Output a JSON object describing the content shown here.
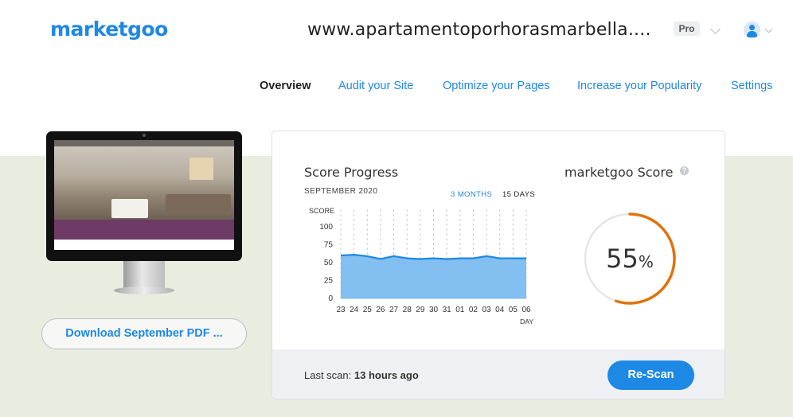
{
  "header": {
    "logo": "marketgoo",
    "site_url": "www.apartamentoporhorasmarbella....",
    "plan": "Pro",
    "user_icon": "user-icon"
  },
  "nav": {
    "items": [
      "Overview",
      "Audit your Site",
      "Optimize your Pages",
      "Increase your Popularity",
      "Settings"
    ],
    "active": "Overview"
  },
  "preview": {
    "download_label": "Download September PDF ..."
  },
  "score_progress": {
    "title": "Score Progress",
    "month": "SEPTEMBER 2020",
    "range_options": [
      "3 MONTHS",
      "15 DAYS"
    ],
    "selected_range": "15 DAYS"
  },
  "chart_data": {
    "type": "area",
    "ylabel": "SCORE",
    "xlabel": "DAY",
    "ylim": [
      0,
      100
    ],
    "yticks": [
      0,
      25,
      50,
      75,
      100
    ],
    "categories": [
      "23",
      "24",
      "25",
      "26",
      "27",
      "28",
      "29",
      "30",
      "31",
      "01",
      "02",
      "03",
      "04",
      "05",
      "06"
    ],
    "series": [
      {
        "values": [
          60,
          61,
          59,
          55,
          59,
          56,
          55,
          56,
          55,
          56,
          56,
          59,
          56,
          56,
          56
        ]
      }
    ],
    "colors": {
      "fill": "#7dbcf1",
      "line": "#1e88e5"
    },
    "grid": "vertical dashed"
  },
  "score": {
    "title": "marketgoo Score",
    "help_icon": "question-icon",
    "value": 55,
    "value_text": "55",
    "unit": "%",
    "colors": {
      "arc": "#e0730c",
      "track": "#e6e6e6"
    }
  },
  "footer": {
    "last_scan_label": "Last scan:",
    "last_scan_value": "13 hours ago",
    "rescan_label": "Re-Scan"
  },
  "colors": {
    "brand": "#1e88e5",
    "band_background": "#e9ede0"
  }
}
